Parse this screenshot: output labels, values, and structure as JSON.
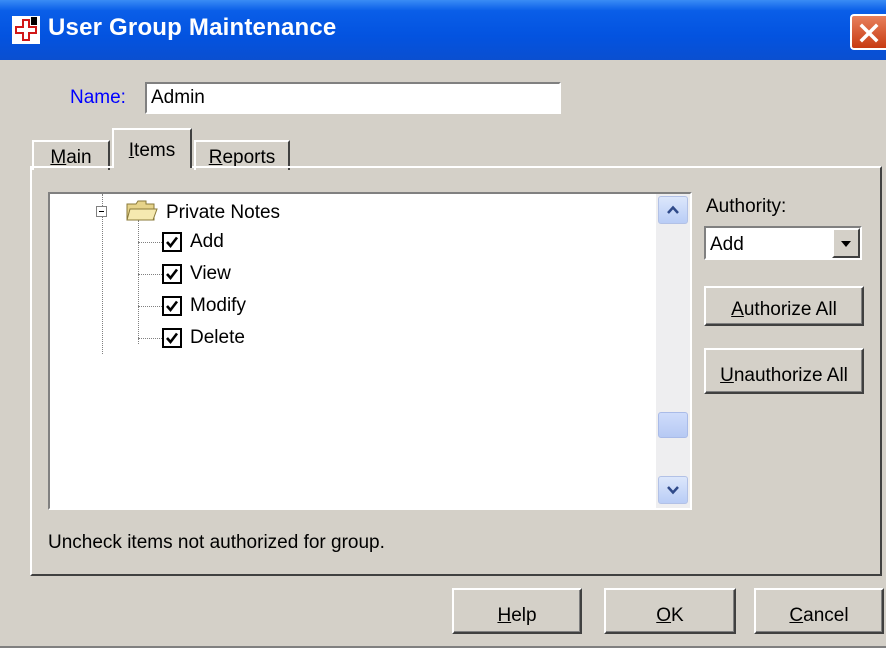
{
  "window": {
    "title": "User Group Maintenance",
    "accent_color": "#0353e0"
  },
  "name_field": {
    "label": "Name:",
    "value": "Admin"
  },
  "tabs": [
    {
      "label": "Main",
      "underline": "M",
      "rest": "ain"
    },
    {
      "label": "Items",
      "underline": "I",
      "rest": "tems",
      "selected": true
    },
    {
      "label": "Reports",
      "underline": "R",
      "rest": "eports"
    }
  ],
  "tree": {
    "folder": {
      "label": "Private Notes",
      "icon": "folder-open-icon"
    },
    "items": [
      {
        "label": "Add",
        "checked": true
      },
      {
        "label": "View",
        "checked": true
      },
      {
        "label": "Modify",
        "checked": true
      },
      {
        "label": "Delete",
        "checked": true
      }
    ]
  },
  "authority": {
    "label": "Authority:",
    "selected": "Add"
  },
  "buttons": {
    "authorize_all": {
      "label": "Authorize All",
      "underline": "A",
      "rest": "uthorize All"
    },
    "unauthorize_all": {
      "label": "Unauthorize All",
      "underline": "U",
      "rest": "nauthorize All"
    },
    "help": {
      "label": "Help",
      "underline": "H",
      "rest": "elp"
    },
    "ok": {
      "label": "OK",
      "underline": "O",
      "rest": "K"
    },
    "cancel": {
      "label": "Cancel",
      "underline": "C",
      "rest": "ancel"
    }
  },
  "hint": "Uncheck items not authorized for group."
}
